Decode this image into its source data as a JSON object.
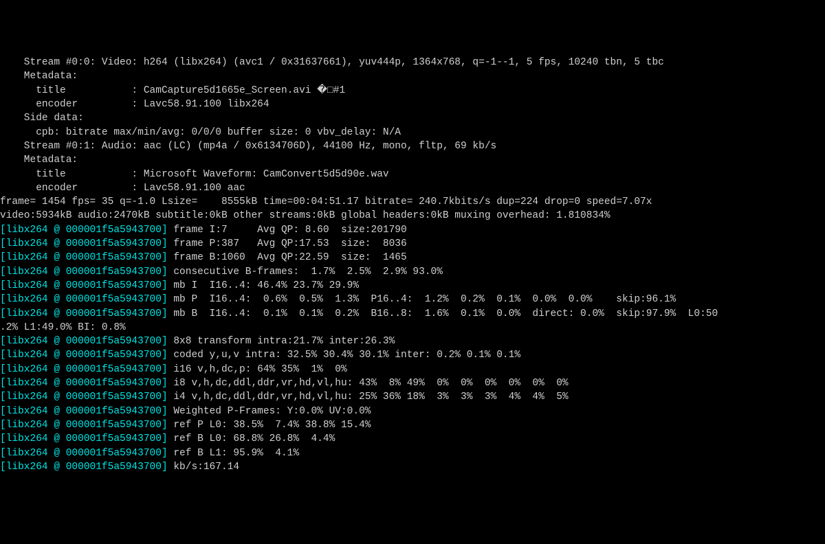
{
  "lines": [
    {
      "cls": "white",
      "text": "    Stream #0:0: Video: h264 (libx264) (avc1 / 0x31637661), yuv444p, 1364x768, q=-1--1, 5 fps, 10240 tbn, 5 tbc"
    },
    {
      "cls": "white",
      "text": "    Metadata:"
    },
    {
      "cls": "white",
      "text": "      title           : CamCapture5d1665e_Screen.avi �□#1"
    },
    {
      "cls": "white",
      "text": "      encoder         : Lavc58.91.100 libx264"
    },
    {
      "cls": "white",
      "text": "    Side data:"
    },
    {
      "cls": "white",
      "text": "      cpb: bitrate max/min/avg: 0/0/0 buffer size: 0 vbv_delay: N/A"
    },
    {
      "cls": "white",
      "text": "    Stream #0:1: Audio: aac (LC) (mp4a / 0x6134706D), 44100 Hz, mono, fltp, 69 kb/s"
    },
    {
      "cls": "white",
      "text": "    Metadata:"
    },
    {
      "cls": "white",
      "text": "      title           : Microsoft Waveform: CamConvert5d5d90e.wav"
    },
    {
      "cls": "white",
      "text": "      encoder         : Lavc58.91.100 aac"
    },
    {
      "cls": "white",
      "text": "frame= 1454 fps= 35 q=-1.0 Lsize=    8555kB time=00:04:51.17 bitrate= 240.7kbits/s dup=224 drop=0 speed=7.07x"
    },
    {
      "cls": "white",
      "text": "video:5934kB audio:2470kB subtitle:0kB other streams:0kB global headers:0kB muxing overhead: 1.810834%"
    },
    {
      "cls": "mixed",
      "prefix": "[libx264 @ 000001f5a5943700]",
      "rest": " frame I:7     Avg QP: 8.60  size:201790"
    },
    {
      "cls": "mixed",
      "prefix": "[libx264 @ 000001f5a5943700]",
      "rest": " frame P:387   Avg QP:17.53  size:  8036"
    },
    {
      "cls": "mixed",
      "prefix": "[libx264 @ 000001f5a5943700]",
      "rest": " frame B:1060  Avg QP:22.59  size:  1465"
    },
    {
      "cls": "mixed",
      "prefix": "[libx264 @ 000001f5a5943700]",
      "rest": " consecutive B-frames:  1.7%  2.5%  2.9% 93.0%"
    },
    {
      "cls": "mixed",
      "prefix": "[libx264 @ 000001f5a5943700]",
      "rest": " mb I  I16..4: 46.4% 23.7% 29.9%"
    },
    {
      "cls": "mixed",
      "prefix": "[libx264 @ 000001f5a5943700]",
      "rest": " mb P  I16..4:  0.6%  0.5%  1.3%  P16..4:  1.2%  0.2%  0.1%  0.0%  0.0%    skip:96.1%"
    },
    {
      "cls": "mixed",
      "prefix": "[libx264 @ 000001f5a5943700]",
      "rest": " mb B  I16..4:  0.1%  0.1%  0.2%  B16..8:  1.6%  0.1%  0.0%  direct: 0.0%  skip:97.9%  L0:50"
    },
    {
      "cls": "white",
      "text": ".2% L1:49.0% BI: 0.8%"
    },
    {
      "cls": "mixed",
      "prefix": "[libx264 @ 000001f5a5943700]",
      "rest": " 8x8 transform intra:21.7% inter:26.3%"
    },
    {
      "cls": "mixed",
      "prefix": "[libx264 @ 000001f5a5943700]",
      "rest": " coded y,u,v intra: 32.5% 30.4% 30.1% inter: 0.2% 0.1% 0.1%"
    },
    {
      "cls": "mixed",
      "prefix": "[libx264 @ 000001f5a5943700]",
      "rest": " i16 v,h,dc,p: 64% 35%  1%  0%"
    },
    {
      "cls": "mixed",
      "prefix": "[libx264 @ 000001f5a5943700]",
      "rest": " i8 v,h,dc,ddl,ddr,vr,hd,vl,hu: 43%  8% 49%  0%  0%  0%  0%  0%  0%"
    },
    {
      "cls": "mixed",
      "prefix": "[libx264 @ 000001f5a5943700]",
      "rest": " i4 v,h,dc,ddl,ddr,vr,hd,vl,hu: 25% 36% 18%  3%  3%  3%  4%  4%  5%"
    },
    {
      "cls": "mixed",
      "prefix": "[libx264 @ 000001f5a5943700]",
      "rest": " Weighted P-Frames: Y:0.0% UV:0.0%"
    },
    {
      "cls": "mixed",
      "prefix": "[libx264 @ 000001f5a5943700]",
      "rest": " ref P L0: 38.5%  7.4% 38.8% 15.4%"
    },
    {
      "cls": "mixed",
      "prefix": "[libx264 @ 000001f5a5943700]",
      "rest": " ref B L0: 68.8% 26.8%  4.4%"
    },
    {
      "cls": "mixed",
      "prefix": "[libx264 @ 000001f5a5943700]",
      "rest": " ref B L1: 95.9%  4.1%"
    },
    {
      "cls": "mixed",
      "prefix": "[libx264 @ 000001f5a5943700]",
      "rest": " kb/s:167.14"
    }
  ]
}
